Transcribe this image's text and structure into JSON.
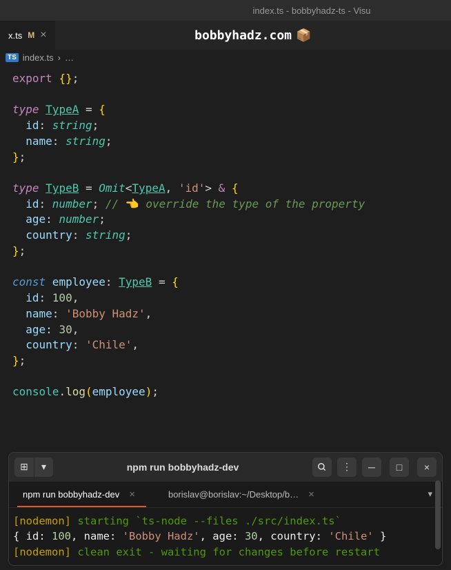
{
  "window": {
    "title": "index.ts - bobbyhadz-ts - Visu"
  },
  "tab": {
    "name": "x.ts",
    "modified": "M"
  },
  "header": {
    "site": "bobbyhadz.com",
    "emoji": "📦"
  },
  "breadcrumb": {
    "badge": "TS",
    "file": "index.ts",
    "sep": "›",
    "rest": "…"
  },
  "code": {
    "l1_export": "export",
    "l1_braces": "{}",
    "l1_semi": ";",
    "l3_type": "type",
    "l3_name": "TypeA",
    "l3_eq": " = ",
    "l3_brace": "{",
    "l4_prop": "id",
    "l4_colon": ": ",
    "l4_vtype": "string",
    "l4_semi": ";",
    "l5_prop": "name",
    "l5_colon": ": ",
    "l5_vtype": "string",
    "l5_semi": ";",
    "l6_brace": "}",
    "l6_semi": ";",
    "l8_type": "type",
    "l8_name": "TypeB",
    "l8_eq": " = ",
    "l8_omit": "Omit",
    "l8_lt": "<",
    "l8_ref": "TypeA",
    "l8_comma": ", ",
    "l8_str": "'id'",
    "l8_gt": ">",
    "l8_amp": " & ",
    "l8_brace": "{",
    "l9_prop": "id",
    "l9_colon": ": ",
    "l9_vtype": "number",
    "l9_semi": ";",
    "l9_comment_slash": " // ",
    "l9_emoji": "👈",
    "l9_comment": " override the type of the property",
    "l10_prop": "age",
    "l10_colon": ": ",
    "l10_vtype": "number",
    "l10_semi": ";",
    "l11_prop": "country",
    "l11_colon": ": ",
    "l11_vtype": "string",
    "l11_semi": ";",
    "l12_brace": "}",
    "l12_semi": ";",
    "l14_const": "const",
    "l14_var": " employee",
    "l14_colon": ": ",
    "l14_type": "TypeB",
    "l14_eq": " = ",
    "l14_brace": "{",
    "l15_prop": "id",
    "l15_colon": ": ",
    "l15_val": "100",
    "l15_comma": ",",
    "l16_prop": "name",
    "l16_colon": ": ",
    "l16_val": "'Bobby Hadz'",
    "l16_comma": ",",
    "l17_prop": "age",
    "l17_colon": ": ",
    "l17_val": "30",
    "l17_comma": ",",
    "l18_prop": "country",
    "l18_colon": ": ",
    "l18_val": "'Chile'",
    "l18_comma": ",",
    "l19_brace": "}",
    "l19_semi": ";",
    "l21_obj": "console",
    "l21_dot": ".",
    "l21_fn": "log",
    "l21_lp": "(",
    "l21_arg": "employee",
    "l21_rp": ")",
    "l21_semi": ";"
  },
  "terminal": {
    "title": "npm run bobbyhadz-dev",
    "tabs": {
      "t1": "npm run bobbyhadz-dev",
      "t2": "borislav@borislav:~/Desktop/b…"
    },
    "out": {
      "l1a": "[nodemon] ",
      "l1b": "starting `ts-node --files ./src/index.ts`",
      "l2a": "{ id: ",
      "l2b": "100",
      "l2c": ", name: ",
      "l2d": "'Bobby Hadz'",
      "l2e": ", age: ",
      "l2f": "30",
      "l2g": ", country: ",
      "l2h": "'Chile'",
      "l2i": " }",
      "l3a": "[nodemon] ",
      "l3b": "clean exit - waiting for changes before restart"
    }
  }
}
